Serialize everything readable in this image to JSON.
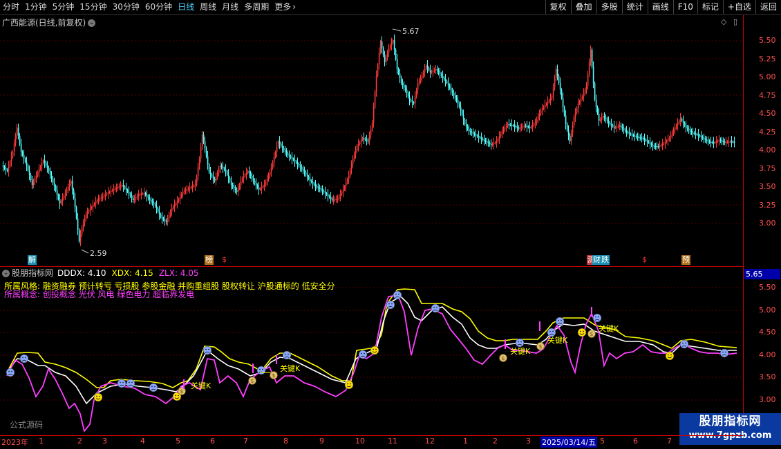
{
  "toolbar": {
    "periods": [
      "分时",
      "1分钟",
      "5分钟",
      "15分钟",
      "30分钟",
      "60分钟",
      "日线",
      "周线",
      "月线",
      "多周期",
      "更多"
    ],
    "active_period": "日线",
    "tools": [
      "复权",
      "叠加",
      "多股",
      "统计",
      "画线",
      "F10",
      "标记",
      "+自选",
      "返回"
    ]
  },
  "main_chart": {
    "title": "广西能源(日线,前复权)",
    "price_ticks": [
      "5.50",
      "5.25",
      "5.00",
      "4.75",
      "4.50",
      "4.25",
      "4.00",
      "3.75",
      "3.50",
      "3.25",
      "3.00"
    ],
    "high_label": "5.67",
    "low_label": "2.59",
    "markers": [
      {
        "text": "解",
        "style": "blue"
      },
      {
        "text": "榜",
        "style": "orange"
      },
      {
        "text": "$",
        "style": "red"
      },
      {
        "text": "测",
        "style": "pink"
      },
      {
        "text": "财",
        "style": "blue"
      },
      {
        "text": "跌",
        "style": "blue"
      },
      {
        "text": "$",
        "style": "red"
      },
      {
        "text": "预",
        "style": "orange"
      }
    ],
    "colors": {
      "up": "#ff3b3b",
      "down": "#54ffff",
      "axis": "#cc0000"
    }
  },
  "indicator": {
    "name": "股朋指标网",
    "dddx_label": "DDDX: 4.10",
    "xdx_label": "XDX: 4.15",
    "zlx_label": "ZLX: 4.05",
    "style_label": "所属风格:",
    "style_text": "融资融券 预计转亏 亏损股 参股金融 并购重组股 股权转让 沪股通标的 低安全分",
    "concept_label": "所属概念:",
    "concept_text": "创投概念 光伏 风电 绿色电力 超临界发电",
    "ticks": [
      "5.50",
      "5.00",
      "4.50",
      "4.00",
      "3.50",
      "3.00"
    ],
    "current_value": "5.65",
    "key_k_label": "关键K",
    "colors": {
      "dddx": "#ffffff",
      "xdx": "#ffff00",
      "zlx": "#ff40ff"
    }
  },
  "footer": {
    "formula_label": "公式源码",
    "dates": [
      "2023年",
      "1",
      "2",
      "3",
      "4",
      "5",
      "6",
      "7",
      "8",
      "9",
      "10",
      "11",
      "12",
      "1",
      "2",
      "3",
      "2025/03/14/五",
      "5",
      "6",
      "7"
    ],
    "watermark_title": "股朋指标网",
    "watermark_url": "www.7gpzb.com"
  }
}
